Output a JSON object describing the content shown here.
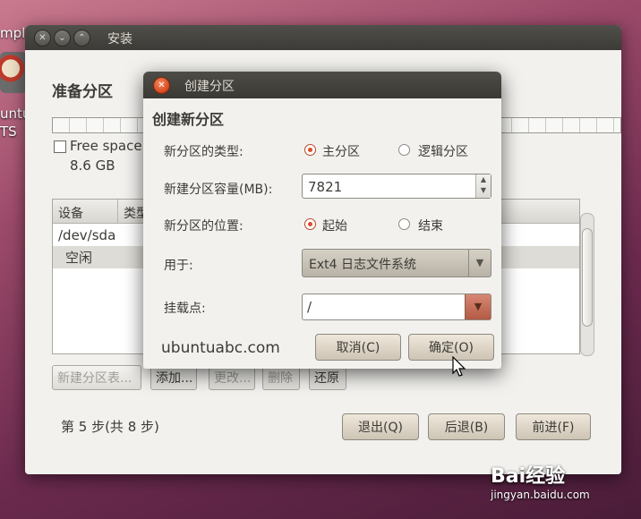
{
  "desktop": {
    "label_top": "mple",
    "label_mid1": "untu",
    "label_mid2": "TS"
  },
  "window": {
    "title": "安装",
    "heading": "准备分区",
    "free_space_label": "Free space",
    "free_space_size": "8.6 GB",
    "table": {
      "col_device": "设备",
      "col_type": "类型",
      "rows": [
        "/dev/sda",
        "空闲"
      ]
    },
    "toolbar": {
      "new_table": "新建分区表...",
      "add": "添加...",
      "change": "更改...",
      "delete": "删除",
      "revert": "还原"
    },
    "step": "第 5 步(共 8 步)",
    "quit": "退出(Q)",
    "back": "后退(B)",
    "forward": "前进(F)"
  },
  "dialog": {
    "title": "创建分区",
    "heading": "创建新分区",
    "type_label": "新分区的类型:",
    "type_primary": "主分区",
    "type_logical": "逻辑分区",
    "type_selected": "primary",
    "size_label": "新建分区容量(MB):",
    "size_value": "7821",
    "location_label": "新分区的位置:",
    "location_start": "起始",
    "location_end": "结束",
    "location_selected": "start",
    "use_as_label": "用于:",
    "use_as_value": "Ext4 日志文件系统",
    "mount_label": "挂载点:",
    "mount_value": "/",
    "watermark": "ubuntuabc.com",
    "cancel": "取消(C)",
    "ok": "确定(O)"
  },
  "brand": {
    "logo_text": "Bai经验",
    "url": "jingyan.baidu.com"
  },
  "colors": {
    "radio_accent": "#df4b2a",
    "titlebar": "#3c3b37"
  }
}
